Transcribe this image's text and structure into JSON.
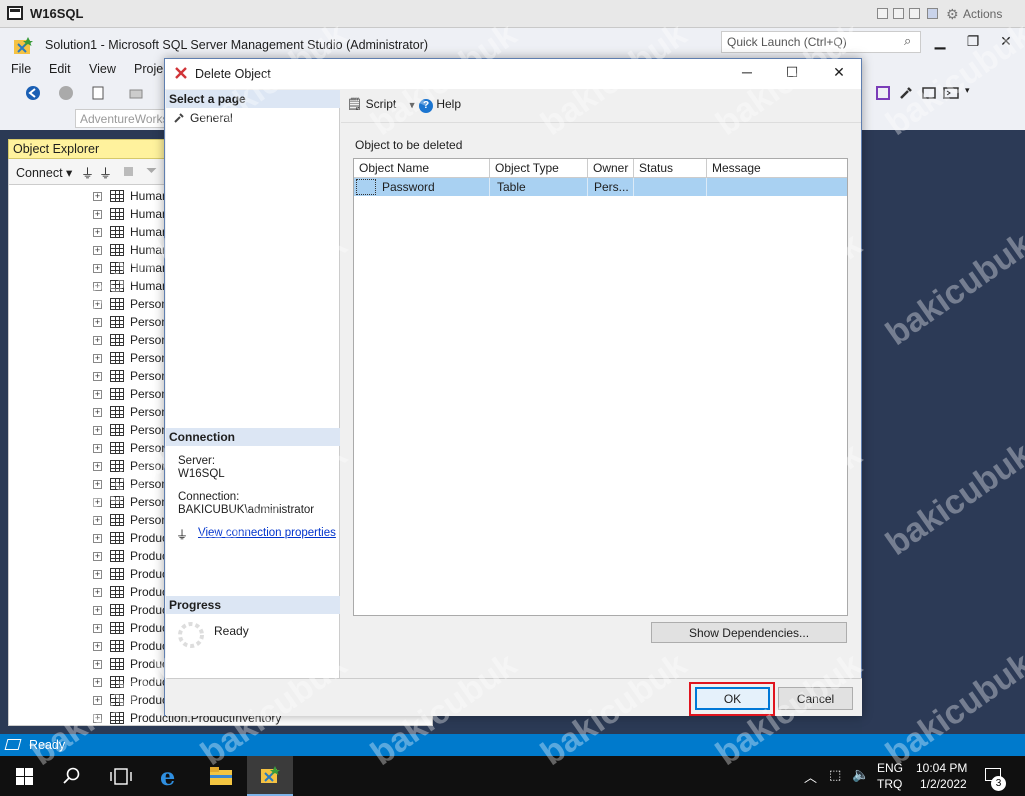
{
  "vm": {
    "title": "W16SQL",
    "actions_label": "Actions"
  },
  "ssms": {
    "title": "Solution1 - Microsoft SQL Server Management Studio (Administrator)",
    "quick_launch_placeholder": "Quick Launch (Ctrl+Q)",
    "menu": [
      "File",
      "Edit",
      "View",
      "Proje"
    ],
    "database_combo": "AdventureWorks",
    "status": "Ready"
  },
  "object_explorer": {
    "title": "Object Explorer",
    "connect_label": "Connect",
    "rows": [
      "Human",
      "Human",
      "Human",
      "Human",
      "Human",
      "Human",
      "Person",
      "Person",
      "Person",
      "Person",
      "Person",
      "Person",
      "Person",
      "Person",
      "Person",
      "Person",
      "Person",
      "Person",
      "Person",
      "Produc",
      "Produc",
      "Produc",
      "Produc",
      "Produc",
      "Produc",
      "Produc",
      "Produc",
      "Produc",
      "Produc",
      "Production.ProductInventory"
    ]
  },
  "dialog": {
    "title": "Delete Object",
    "select_page_header": "Select a page",
    "pages": [
      "General"
    ],
    "connection_header": "Connection",
    "server_label": "Server:",
    "server_value": "W16SQL",
    "connection_label": "Connection:",
    "connection_value": "BAKICUBUK\\administrator",
    "view_connection_link": "View connection properties",
    "progress_header": "Progress",
    "progress_status": "Ready",
    "script_label": "Script",
    "help_label": "Help",
    "objects_label": "Object to be deleted",
    "grid": {
      "columns": [
        "Object Name",
        "Object Type",
        "Owner",
        "Status",
        "Message"
      ],
      "rows": [
        [
          "Password",
          "Table",
          "Pers...",
          "",
          ""
        ]
      ]
    },
    "show_dependencies_label": "Show Dependencies...",
    "ok_label": "OK",
    "cancel_label": "Cancel"
  },
  "taskbar": {
    "language_1": "ENG",
    "language_2": "TRQ",
    "time": "10:04 PM",
    "date": "1/2/2022",
    "notifications_count": "3"
  },
  "watermark": "bakicubuk"
}
